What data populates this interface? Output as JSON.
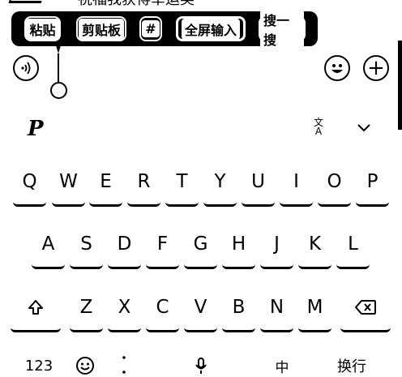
{
  "chat": {
    "partial_text": "祝福我获得幸运奖"
  },
  "popup": {
    "paste": "粘贴",
    "clipboard": "剪贴板",
    "hash": "#",
    "fullscreen_input": "全屏输入",
    "search": "搜一搜"
  },
  "toolbar": {
    "voice_icon": "voice-icon",
    "emoji_icon": "emoji-icon",
    "plus_icon": "plus-icon",
    "plus_glyph": "+"
  },
  "keyboard": {
    "logo": "P",
    "translate_line1": "文",
    "translate_line2": "A",
    "collapse_glyph": "⌄",
    "row1": [
      "Q",
      "W",
      "E",
      "R",
      "T",
      "Y",
      "U",
      "I",
      "O",
      "P"
    ],
    "row2": [
      "A",
      "S",
      "D",
      "F",
      "G",
      "H",
      "J",
      "K",
      "L"
    ],
    "row3": [
      "Z",
      "X",
      "C",
      "V",
      "B",
      "N",
      "M"
    ],
    "bottom": {
      "numbers": "123",
      "lang": "中",
      "enter": "换行"
    }
  }
}
